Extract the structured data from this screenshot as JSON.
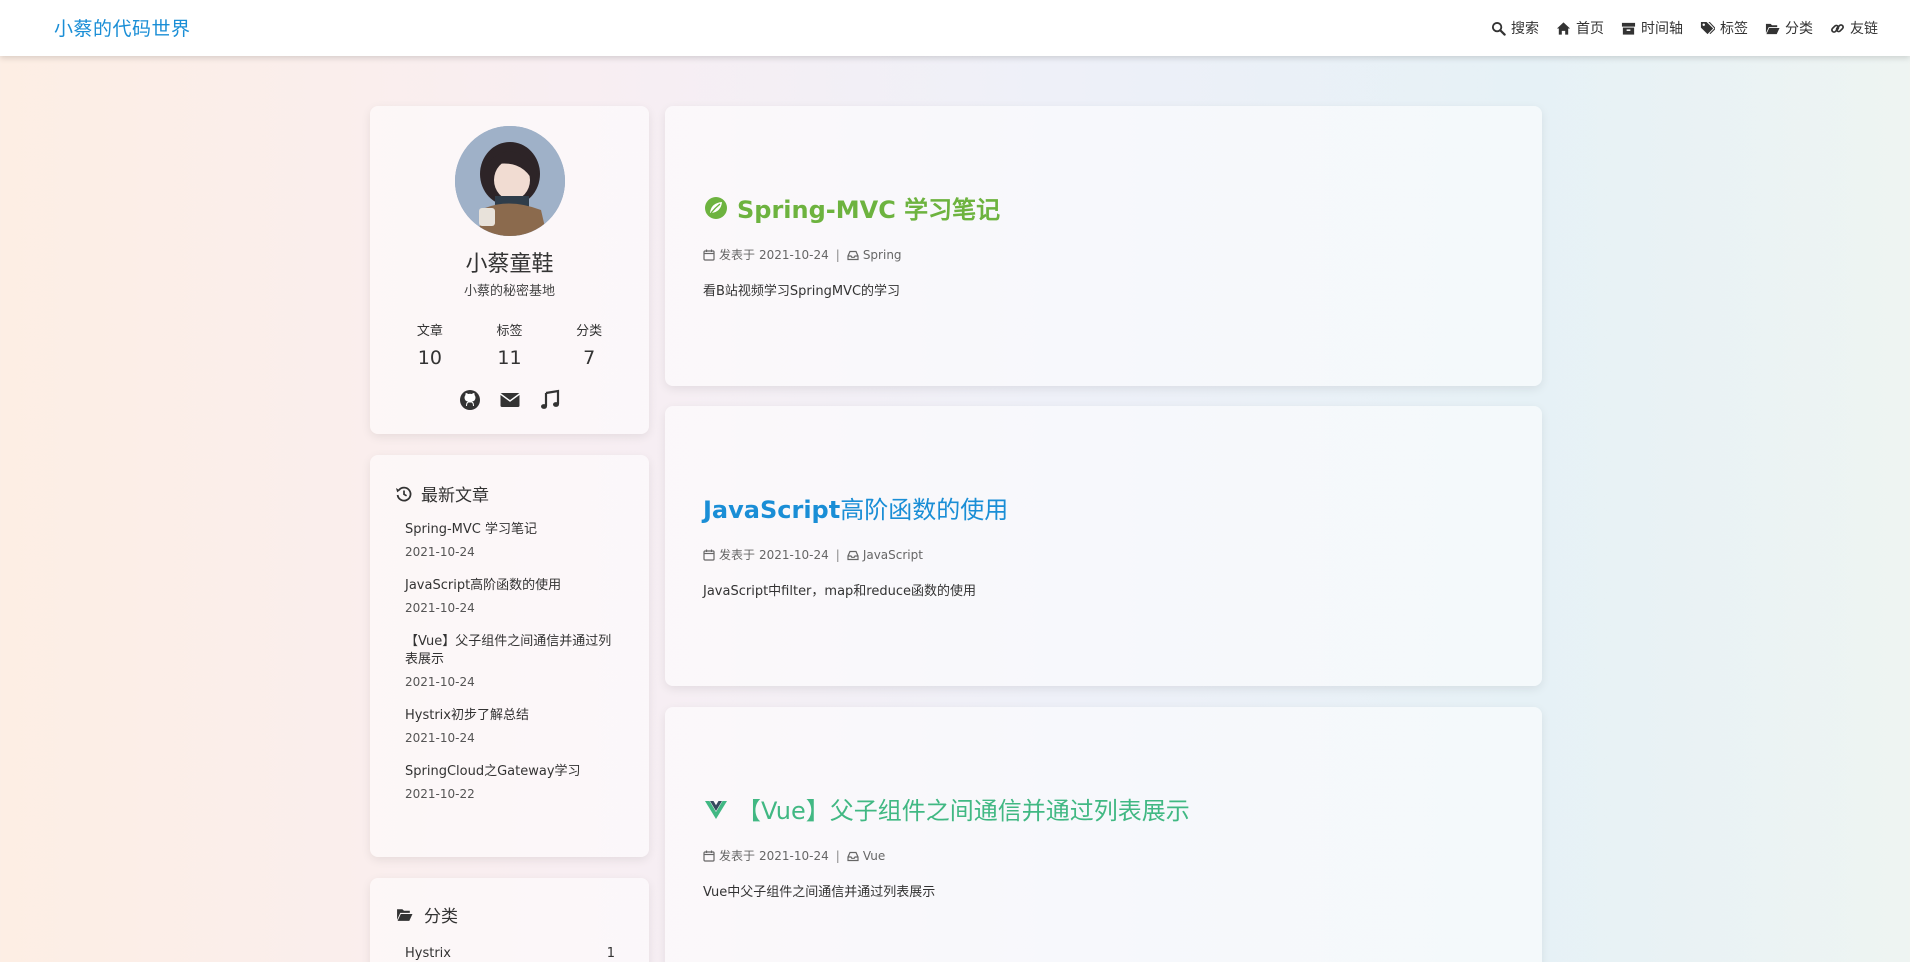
{
  "brand": "小蔡的代码世界",
  "nav": [
    {
      "label": "搜索",
      "icon": "search-icon"
    },
    {
      "label": "首页",
      "icon": "home-icon"
    },
    {
      "label": "时间轴",
      "icon": "archive-icon"
    },
    {
      "label": "标签",
      "icon": "tags-icon"
    },
    {
      "label": "分类",
      "icon": "folder-open-icon"
    },
    {
      "label": "友链",
      "icon": "link-icon"
    }
  ],
  "profile": {
    "name": "小蔡童鞋",
    "subtitle": "小蔡的秘密基地",
    "stats": [
      {
        "label": "文章",
        "value": "10"
      },
      {
        "label": "标签",
        "value": "11"
      },
      {
        "label": "分类",
        "value": "7"
      }
    ],
    "socials": [
      "github-icon",
      "envelope-icon",
      "music-icon"
    ]
  },
  "recent": {
    "title": "最新文章",
    "items": [
      {
        "title": "Spring-MVC 学习笔记",
        "date": "2021-10-24"
      },
      {
        "title": "JavaScript高阶函数的使用",
        "date": "2021-10-24"
      },
      {
        "title": "【Vue】父子组件之间通信并通过列表展示",
        "date": "2021-10-24"
      },
      {
        "title": "Hystrix初步了解总结",
        "date": "2021-10-24"
      },
      {
        "title": "SpringCloud之Gateway学习",
        "date": "2021-10-22"
      }
    ]
  },
  "categories": {
    "title": "分类",
    "items": [
      {
        "name": "Hystrix",
        "count": "1"
      }
    ]
  },
  "posts": [
    {
      "title": "Spring-MVC 学习笔记",
      "meta_prefix": "发表于",
      "date": "2021-10-24",
      "category": "Spring",
      "description": "看B站视频学习SpringMVC的学习",
      "accent": "#6db33f"
    },
    {
      "title_strong": "JavaScript",
      "title_rest": "高阶函数的使用",
      "meta_prefix": "发表于",
      "date": "2021-10-24",
      "category": "JavaScript",
      "description": "JavaScript中filter，map和reduce函数的使用",
      "accent": "#1a8ed6"
    },
    {
      "title": "【Vue】父子组件之间通信并通过列表展示",
      "meta_prefix": "发表于",
      "date": "2021-10-24",
      "category": "Vue",
      "description": "Vue中父子组件之间通信并通过列表展示",
      "accent": "#41b883"
    }
  ]
}
